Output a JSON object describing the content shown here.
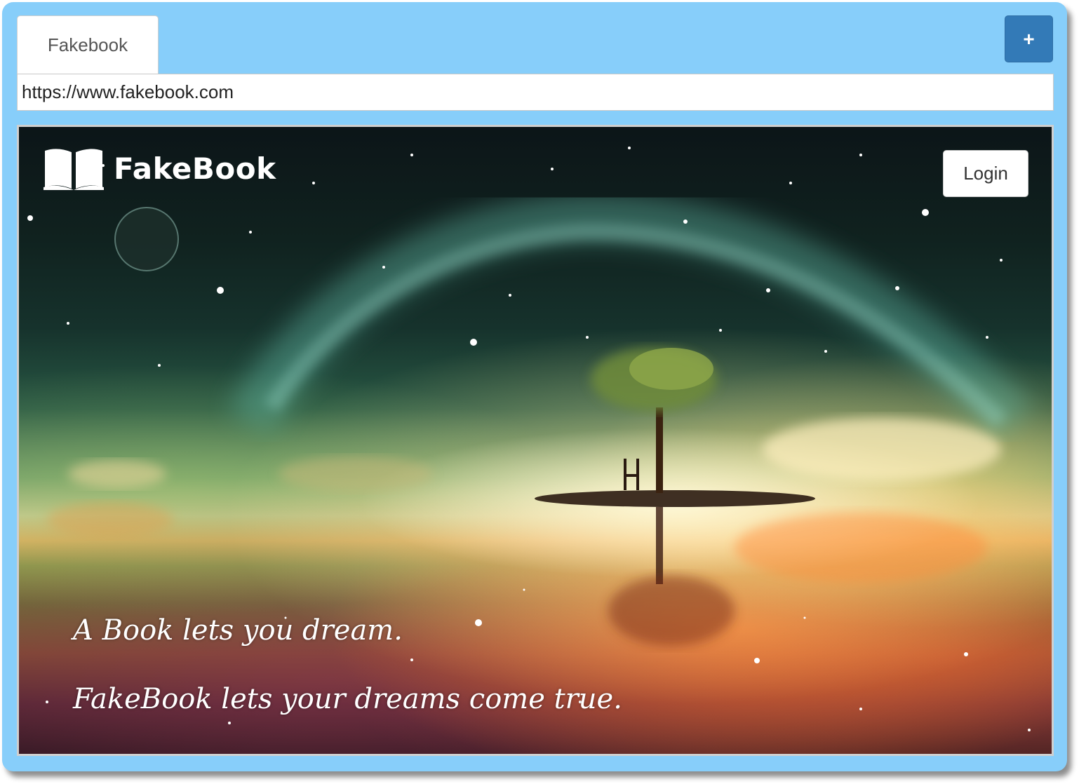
{
  "browser": {
    "tabs": [
      {
        "label": "Fakebook",
        "active": true
      }
    ],
    "new_tab_label": "+",
    "url": "https://www.fakebook.com",
    "accent_color": "#337ab7",
    "frame_color": "#87cefa"
  },
  "page": {
    "logo_text": "FakeBook",
    "logo_icon": "open-book-icon",
    "login_label": "Login",
    "tagline_line1": "A Book lets you dream.",
    "tagline_line2": "FakeBook lets your dreams come true."
  }
}
